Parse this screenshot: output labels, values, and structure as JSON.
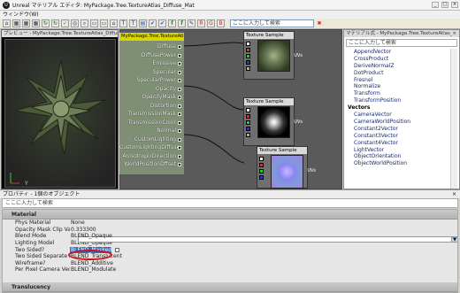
{
  "window": {
    "title": "Unreal マテリアル エディタ: MyPackage.Tree.TextureAtlas_Diffuse_Mat",
    "minimize": "_",
    "maximize": "□",
    "close": "×"
  },
  "menu": {
    "window": "ウィンドウ(W)"
  },
  "toolbar": {
    "search_placeholder": "ここに入力して検索",
    "icons": [
      "home-icon",
      "grid-icon",
      "grid-icon",
      "grid-icon",
      "realtime-icon",
      "realtime-icon",
      "apply-icon",
      "find-icon",
      "zoom-icon",
      "layout-icon",
      "layout-icon",
      "home-icon",
      "tag-icon",
      "tag-icon",
      "stats-icon",
      "check-icon",
      "check-icon",
      "function-icon",
      "function-icon",
      "clean-icon",
      "color-r-icon",
      "color-g-icon",
      "color-b-icon"
    ],
    "glyphs": [
      "⌂",
      "▦",
      "▦",
      "▦",
      "↻",
      "↻",
      "✓",
      "◎",
      "⌕",
      "▭",
      "▭",
      "⌂",
      "T",
      "T",
      "▤",
      "✔",
      "✔",
      "f",
      "f",
      "✎",
      "R",
      "G",
      "B"
    ]
  },
  "preview": {
    "title": "プレビュー - MyPackage.Tree.TextureAtlas_Diffuse_Mat",
    "close": "×",
    "axis_label": "Y"
  },
  "graph": {
    "main_node": {
      "title": "MyPackage.Tree.TextureAtlas_Diffuse_Mat",
      "pins": [
        "Diffuse",
        "DiffusePower",
        "Emissive",
        "Specular",
        "SpecularPower",
        "Opacity",
        "OpacityMask",
        "Distortion",
        "TransmissionMask",
        "TransmissionColor",
        "Normal",
        "CustomLighting",
        "CustomLightingDiffuse",
        "AnisotropicDirection",
        "WorldPositionOffset"
      ]
    },
    "texture_nodes": [
      {
        "title": "Texture Sample",
        "uv_label": "UVs"
      },
      {
        "title": "Texture Sample",
        "uv_label": "UVs"
      },
      {
        "title": "Texture Sample",
        "uv_label": "UVs"
      }
    ]
  },
  "palette": {
    "title": "マテリアル式 - MyPackage.Tree.TextureAtlas_Diffuse_Mat",
    "close": "×",
    "search_placeholder": "ここに入力して検索",
    "items_top": [
      "AppendVector",
      "CrossProduct",
      "DeriveNormalZ",
      "DotProduct",
      "Fresnel",
      "Normalize",
      "Transform",
      "TransformPosition"
    ],
    "category": "Vectors",
    "items_vectors": [
      "CameraVector",
      "CameraWorldPosition",
      "Constant2Vector",
      "Constant3Vector",
      "Constant4Vector",
      "LightVector",
      "ObjectOrientation",
      "ObjectWorldPosition"
    ]
  },
  "properties": {
    "title": "プロパティ - 1個のオブジェクト",
    "close": "×",
    "search_placeholder": "ここに入力して検索",
    "category_material": "Material",
    "category_translucency": "Translucency",
    "rows": [
      {
        "label": "Phys Material",
        "value": "None"
      },
      {
        "label": "Opacity Mask Clip Value",
        "value": "0.333300"
      },
      {
        "label": "Blend Mode",
        "value": "BLEND_Opaque"
      },
      {
        "label": "Lighting Model",
        "value": "BLEND_Opaque"
      },
      {
        "label": "Two Sided?",
        "value": "BLEND_Masked"
      },
      {
        "label": "Two Sided Separate Pas",
        "value": "BLEND_Translucent"
      },
      {
        "label": "Wireframe?",
        "value": "BLEND_Additive"
      },
      {
        "label": "Per Pixel Camera Vector",
        "value": "BLEND_Modulate"
      }
    ],
    "dropdown_options": [
      "BLEND_Opaque",
      "BLEND_Masked",
      "BLEND_Translucent",
      "BLEND_Additive",
      "BLEND_Modulate"
    ],
    "selected_option": "BLEND_Masked",
    "highlight_color": "#3169c6",
    "annotation_color": "#d01010"
  }
}
